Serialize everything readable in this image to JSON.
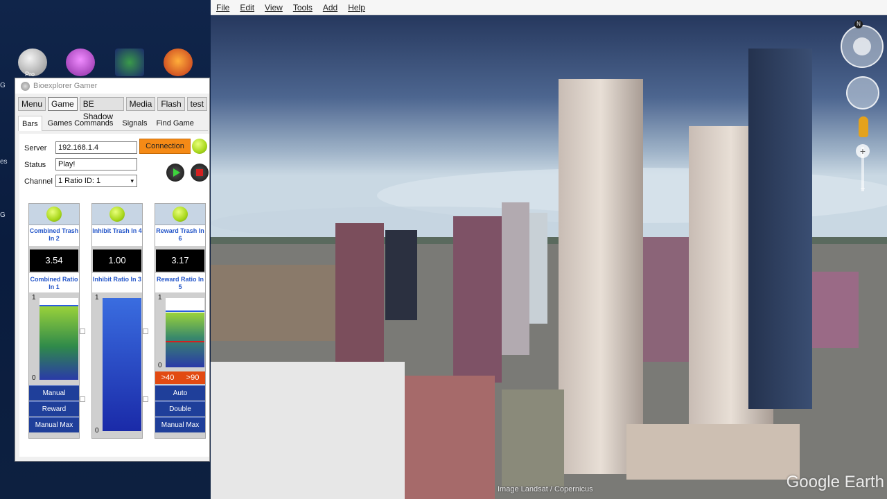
{
  "desktop": {
    "icons": [
      {
        "name": "google-earth-pro-desktop-icon",
        "label": "Pro",
        "color": "#c9c9c9"
      },
      {
        "name": "podcast-desktop-icon",
        "label": "",
        "color": "#b050c0"
      },
      {
        "name": "brain-map-desktop-icon",
        "label": "",
        "color": "#2a7a3a"
      },
      {
        "name": "brain-activity-desktop-icon",
        "label": "",
        "color": "#d0521a"
      }
    ],
    "edge_letters": [
      "G",
      "es",
      "G"
    ]
  },
  "google_earth": {
    "menu": [
      "File",
      "Edit",
      "View",
      "Tools",
      "Add",
      "Help"
    ],
    "credit": "Image Landsat / Copernicus",
    "logo": "Google Earth",
    "compass_north": "N",
    "zoom_plus": "+",
    "zoom_minus": "−"
  },
  "bioexplorer": {
    "title": "Bioexplorer Gamer",
    "top_tabs": [
      "Menu",
      "Game",
      "BE Shadow",
      "Media",
      "Flash",
      "test"
    ],
    "active_top_tab": 1,
    "sub_tabs": [
      "Bars",
      "Games Commands",
      "Signals",
      "Find Game"
    ],
    "active_sub_tab": 0,
    "server_label": "Server",
    "server_value": "192.168.1.4",
    "connection_button": "Connection",
    "status_label": "Status",
    "status_value": "Play!",
    "channel_label": "Channel",
    "channel_value": "1 Ratio ID: 1",
    "columns": [
      {
        "trash_label": "Combined Trash In 2",
        "value": "3.54",
        "ratio_label": "Combined Ratio In 1",
        "scale_top": "1",
        "scale_bottom": "0",
        "level": 0.91,
        "buttons": [
          "Manual",
          "Reward",
          "Manual Max"
        ]
      },
      {
        "trash_label": "Inhibit Trash In 4",
        "value": "1.00",
        "ratio_label": "Inhibit Ratio In 3",
        "scale_top": "1",
        "scale_bottom": "0",
        "level": 1.0,
        "buttons": []
      },
      {
        "trash_label": "Reward Trash In 6",
        "value": "3.17",
        "ratio_label": "Reward Ratio In 5",
        "scale_top": "1",
        "scale_bottom": "0",
        "level": 0.79,
        "thresholds": [
          ">40",
          ">90"
        ],
        "buttons": [
          "Auto",
          "Double",
          "Manual Max"
        ]
      }
    ]
  }
}
